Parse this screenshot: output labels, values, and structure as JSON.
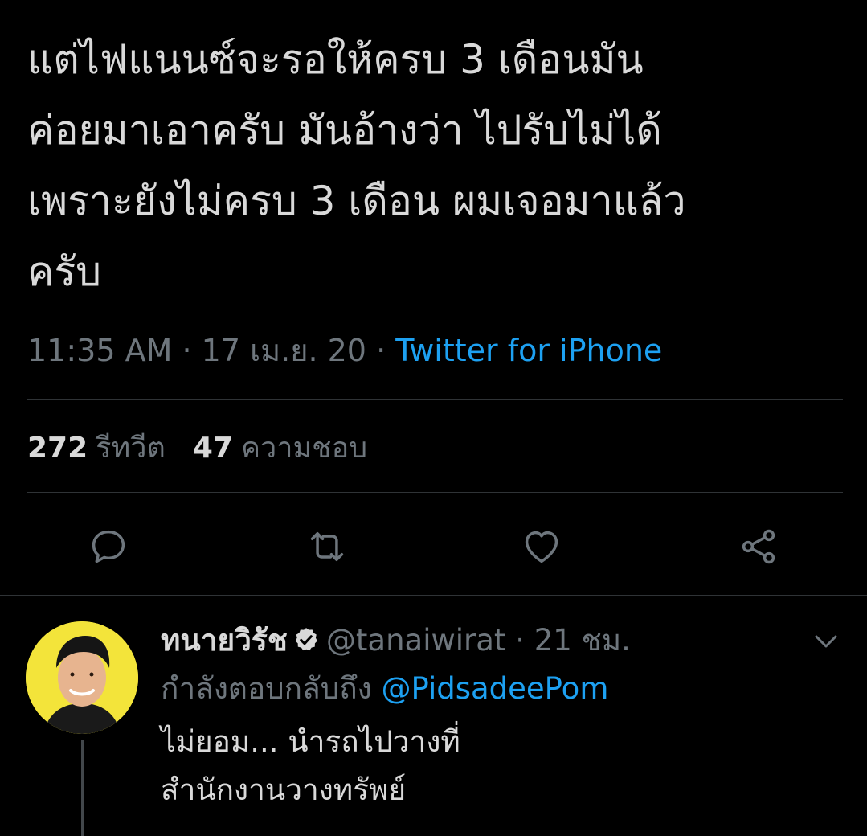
{
  "tweet": {
    "text": "แต่ไฟแนนซ์จะรอให้ครบ 3 เดือนมัน\nค่อยมาเอาครับ มันอ้างว่า ไปรับไม่ได้\nเพราะยังไม่ครบ 3 เดือน ผมเจอมาแล้ว\nครับ",
    "time": "11:35 AM",
    "date": "17 เม.ย. 20",
    "separator": "·",
    "source": "Twitter for iPhone"
  },
  "stats": {
    "retweets_count": "272",
    "retweets_label": "รีทวีต",
    "likes_count": "47",
    "likes_label": "ความชอบ"
  },
  "actions": {
    "icons": [
      "reply-icon",
      "retweet-icon",
      "like-icon",
      "share-icon"
    ]
  },
  "reply": {
    "display_name": "ทนายวิรัช",
    "handle": "@tanaiwirat",
    "separator": "·",
    "age": "21 ชม.",
    "replying_to_label": "กำลังตอบกลับถึง",
    "replying_to_handle": "@PidsadeePom",
    "text": "ไม่ยอม... นำรถไปวางที่\nสำนักงานวางทรัพย์"
  },
  "colors": {
    "background": "#000000",
    "text_primary": "#d9d9d9",
    "text_secondary": "#6e767d",
    "accent": "#1da1f2",
    "divider": "#2f3336",
    "avatar_background": "#f3e43a"
  }
}
